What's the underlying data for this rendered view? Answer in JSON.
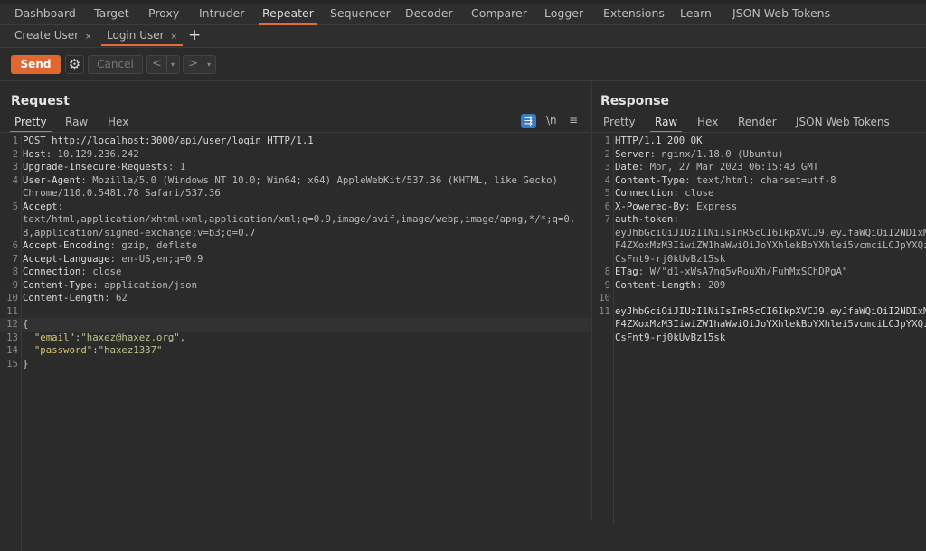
{
  "nav": {
    "items": [
      "Dashboard",
      "Target",
      "Proxy",
      "Intruder",
      "Repeater",
      "Sequencer",
      "Decoder",
      "Comparer",
      "Logger",
      "Extensions",
      "Learn",
      "JSON Web Tokens"
    ],
    "active": "Repeater"
  },
  "repeater_tabs": [
    {
      "label": "Create User",
      "close": "×"
    },
    {
      "label": "Login User",
      "close": "×",
      "active": true
    }
  ],
  "add_tab": "+",
  "toolbar": {
    "send": "Send",
    "settings_icon": "gear-icon",
    "cancel": "Cancel",
    "prev": "<",
    "next": ">",
    "dropdown": "▾"
  },
  "colors": {
    "accent": "#e0672f",
    "background": "#2b2b2b"
  },
  "request": {
    "title": "Request",
    "tabs": [
      "Pretty",
      "Raw",
      "Hex"
    ],
    "active_tab": "Pretty",
    "icons": {
      "wrap": "⇶",
      "newline": "\\n",
      "menu": "≡"
    },
    "lines": [
      {
        "n": "1",
        "parts": [
          [
            "k",
            "POST http://localhost:3000/api/user/login HTTP/1.1"
          ]
        ]
      },
      {
        "n": "2",
        "parts": [
          [
            "k",
            "Host"
          ],
          [
            "v",
            ": 10.129.236.242"
          ]
        ]
      },
      {
        "n": "3",
        "parts": [
          [
            "k",
            "Upgrade-Insecure-Requests"
          ],
          [
            "v",
            ": 1"
          ]
        ]
      },
      {
        "n": "4",
        "parts": [
          [
            "k",
            "User-Agent"
          ],
          [
            "v",
            ": Mozilla/5.0 (Windows NT 10.0; Win64; x64) AppleWebKit/537.36 (KHTML, like Gecko)"
          ]
        ]
      },
      {
        "n": "",
        "parts": [
          [
            "v",
            "Chrome/110.0.5481.78 Safari/537.36"
          ]
        ]
      },
      {
        "n": "5",
        "parts": [
          [
            "k",
            "Accept"
          ],
          [
            "v",
            ":"
          ]
        ]
      },
      {
        "n": "",
        "parts": [
          [
            "v",
            "text/html,application/xhtml+xml,application/xml;q=0.9,image/avif,image/webp,image/apng,*/*;q=0."
          ]
        ]
      },
      {
        "n": "",
        "parts": [
          [
            "v",
            "8,application/signed-exchange;v=b3;q=0.7"
          ]
        ]
      },
      {
        "n": "6",
        "parts": [
          [
            "k",
            "Accept-Encoding"
          ],
          [
            "v",
            ": gzip, deflate"
          ]
        ]
      },
      {
        "n": "7",
        "parts": [
          [
            "k",
            "Accept-Language"
          ],
          [
            "v",
            ": en-US,en;q=0.9"
          ]
        ]
      },
      {
        "n": "8",
        "parts": [
          [
            "k",
            "Connection"
          ],
          [
            "v",
            ": close"
          ]
        ]
      },
      {
        "n": "9",
        "parts": [
          [
            "k",
            "Content-Type"
          ],
          [
            "v",
            ": application/json"
          ]
        ]
      },
      {
        "n": "10",
        "parts": [
          [
            "k",
            "Content-Length"
          ],
          [
            "v",
            ": 62"
          ]
        ]
      },
      {
        "n": "11",
        "parts": []
      },
      {
        "n": "12",
        "parts": [
          [
            "p",
            "{"
          ]
        ],
        "hl": true
      },
      {
        "n": "13",
        "parts": [
          [
            "p",
            "  "
          ],
          [
            "jk",
            "\"email\""
          ],
          [
            "p",
            ":"
          ],
          [
            "js",
            "\"haxez@haxez.org\""
          ],
          [
            "p",
            ","
          ]
        ]
      },
      {
        "n": "14",
        "parts": [
          [
            "p",
            "  "
          ],
          [
            "jk",
            "\"password\""
          ],
          [
            "p",
            ":"
          ],
          [
            "js",
            "\"haxez1337\""
          ]
        ]
      },
      {
        "n": "15",
        "parts": [
          [
            "p",
            "}"
          ]
        ]
      }
    ]
  },
  "response": {
    "title": "Response",
    "tabs": [
      "Pretty",
      "Raw",
      "Hex",
      "Render",
      "JSON Web Tokens"
    ],
    "active_tab": "Raw",
    "lines": [
      {
        "n": "1",
        "parts": [
          [
            "k",
            "HTTP/1.1 200 OK"
          ]
        ]
      },
      {
        "n": "2",
        "parts": [
          [
            "k",
            "Server"
          ],
          [
            "v",
            ": nginx/1.18.0 (Ubuntu)"
          ]
        ]
      },
      {
        "n": "3",
        "parts": [
          [
            "k",
            "Date"
          ],
          [
            "v",
            ": Mon, 27 Mar 2023 06:15:43 GMT"
          ]
        ]
      },
      {
        "n": "4",
        "parts": [
          [
            "k",
            "Content-Type"
          ],
          [
            "v",
            ": text/html; charset=utf-8"
          ]
        ]
      },
      {
        "n": "5",
        "parts": [
          [
            "k",
            "Connection"
          ],
          [
            "v",
            ": close"
          ]
        ]
      },
      {
        "n": "6",
        "parts": [
          [
            "k",
            "X-Powered-By"
          ],
          [
            "v",
            ": Express"
          ]
        ]
      },
      {
        "n": "7",
        "parts": [
          [
            "k",
            "auth-token"
          ],
          [
            "v",
            ":"
          ]
        ]
      },
      {
        "n": "",
        "parts": [
          [
            "v",
            "eyJhbGciOiJIUzI1NiIsInR5cCI6IkpXVCJ9.eyJfaWQiOiI2NDIxM"
          ]
        ]
      },
      {
        "n": "",
        "parts": [
          [
            "v",
            "F4ZXoxMzM3IiwiZW1haWwiOiJoYXhlekBoYXhlei5vcmciLCJpYXQi"
          ]
        ]
      },
      {
        "n": "",
        "parts": [
          [
            "v",
            "CsFnt9-rj0kUvBz15sk"
          ]
        ]
      },
      {
        "n": "8",
        "parts": [
          [
            "k",
            "ETag"
          ],
          [
            "v",
            ": W/\"d1-xWsA7nq5vRouXh/FuhMxSChDPgA\""
          ]
        ]
      },
      {
        "n": "9",
        "parts": [
          [
            "k",
            "Content-Length"
          ],
          [
            "v",
            ": 209"
          ]
        ]
      },
      {
        "n": "10",
        "parts": []
      },
      {
        "n": "11",
        "parts": [
          [
            "k",
            "eyJhbGciOiJIUzI1NiIsInR5cCI6IkpXVCJ9.eyJfaWQiOiI2NDIxM"
          ]
        ]
      },
      {
        "n": "",
        "parts": [
          [
            "k",
            "F4ZXoxMzM3IiwiZW1haWwiOiJoYXhlekBoYXhlei5vcmciLCJpYXQi"
          ]
        ]
      },
      {
        "n": "",
        "parts": [
          [
            "k",
            "CsFnt9-rj0kUvBz15sk"
          ]
        ]
      }
    ]
  }
}
